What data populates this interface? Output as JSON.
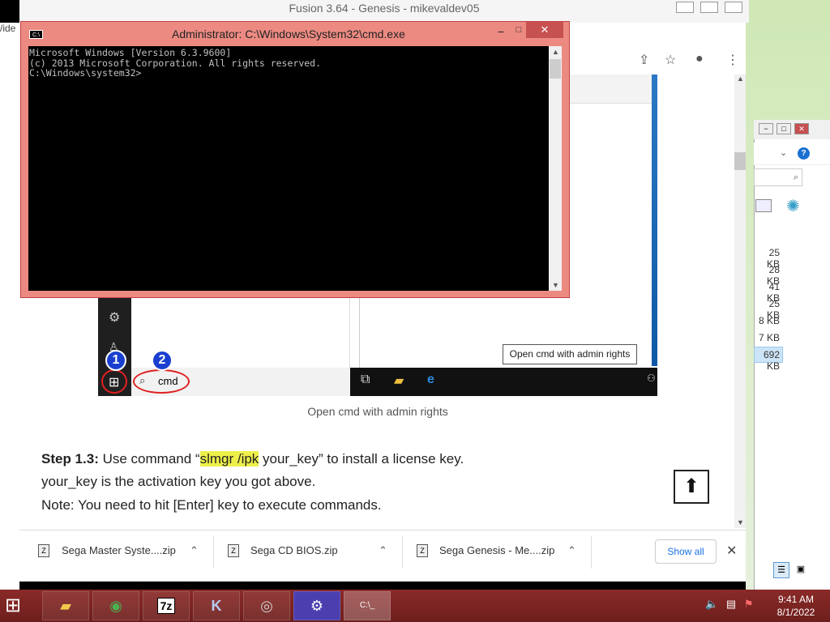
{
  "background_window": {
    "title": "Fusion 3.64 - Genesis - mikevaldev05"
  },
  "left_sliver": {
    "text": "/ide"
  },
  "cmd_window": {
    "title": "Administrator: C:\\Windows\\System32\\cmd.exe",
    "console_lines": [
      "Microsoft Windows [Version 6.3.9600]",
      "(c) 2013 Microsoft Corporation. All rights reserved.",
      "",
      "C:\\Windows\\system32>"
    ],
    "minimize": "−",
    "maximize": "□",
    "close": "✕"
  },
  "article": {
    "screenshot": {
      "search_text": "cmd",
      "badge1": "1",
      "badge2": "2",
      "tooltip": "Open cmd with admin rights"
    },
    "caption": "Open cmd with admin rights",
    "step_label": "Step 1.3:",
    "step_pre": " Use command “",
    "step_highlight": "slmgr /ipk",
    "step_post": " your_key” to install a license key.",
    "line2": "your_key is the activation key you got above.",
    "line3": "Note: You need to hit [Enter] key to execute commands.",
    "back_to_top": "⬆"
  },
  "downloads": {
    "items": [
      {
        "name": "Sega Master Syste....zip"
      },
      {
        "name": "Sega CD BIOS.zip"
      },
      {
        "name": "Sega Genesis - Me....zip"
      }
    ],
    "show_all": "Show all",
    "close": "✕"
  },
  "explorer": {
    "sizes": [
      "25 KB",
      "28 KB",
      "41 KB",
      "25 KB",
      "8 KB",
      "7 KB",
      "692 KB"
    ],
    "help": "?"
  },
  "taskbar": {
    "apps": [
      "file-explorer",
      "chrome",
      "7-zip",
      "kega-fusion",
      "speaker-app",
      "settings",
      "cmd"
    ],
    "app_7zip_label": "7z",
    "time": "9:41 AM",
    "date": "8/1/2022"
  },
  "colors": {
    "cmd_frame": "#ec8a82",
    "taskbar": "#7a2523",
    "highlight": "#eef04a",
    "annotation_red": "#e02020",
    "badge_blue": "#1a3fd0"
  }
}
